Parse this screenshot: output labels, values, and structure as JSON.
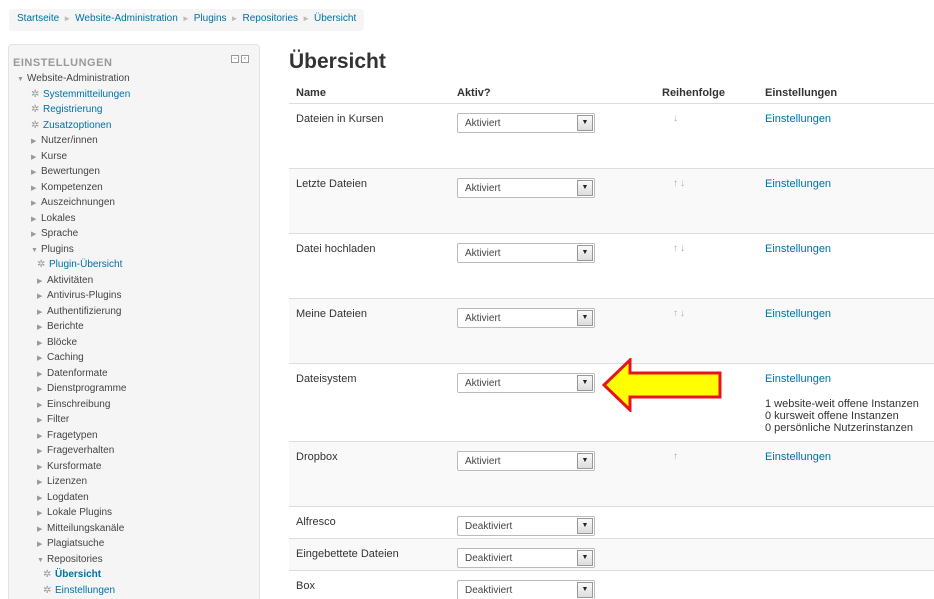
{
  "breadcrumb": {
    "items": [
      "Startseite",
      "Website-Administration",
      "Plugins",
      "Repositories"
    ],
    "current": "Übersicht",
    "separator": "►"
  },
  "sidebar": {
    "title": "EINSTELLUNGEN",
    "items": [
      {
        "label": "Website-Administration",
        "kind": "expanded",
        "level": 1
      },
      {
        "label": "Systemmitteilungen",
        "kind": "gear",
        "level": 2,
        "link": true
      },
      {
        "label": "Registrierung",
        "kind": "gear",
        "level": 2,
        "link": true
      },
      {
        "label": "Zusatzoptionen",
        "kind": "gear",
        "level": 2,
        "link": true
      },
      {
        "label": "Nutzer/innen",
        "kind": "collapsed",
        "level": 2
      },
      {
        "label": "Kurse",
        "kind": "collapsed",
        "level": 2
      },
      {
        "label": "Bewertungen",
        "kind": "collapsed",
        "level": 2
      },
      {
        "label": "Kompetenzen",
        "kind": "collapsed",
        "level": 2
      },
      {
        "label": "Auszeichnungen",
        "kind": "collapsed",
        "level": 2
      },
      {
        "label": "Lokales",
        "kind": "collapsed",
        "level": 2
      },
      {
        "label": "Sprache",
        "kind": "collapsed",
        "level": 2
      },
      {
        "label": "Plugins",
        "kind": "expanded",
        "level": 2
      },
      {
        "label": "Plugin-Übersicht",
        "kind": "gear",
        "level": 3,
        "link": true
      },
      {
        "label": "Aktivitäten",
        "kind": "collapsed",
        "level": 3
      },
      {
        "label": "Antivirus-Plugins",
        "kind": "collapsed",
        "level": 3
      },
      {
        "label": "Authentifizierung",
        "kind": "collapsed",
        "level": 3
      },
      {
        "label": "Berichte",
        "kind": "collapsed",
        "level": 3
      },
      {
        "label": "Blöcke",
        "kind": "collapsed",
        "level": 3
      },
      {
        "label": "Caching",
        "kind": "collapsed",
        "level": 3
      },
      {
        "label": "Datenformate",
        "kind": "collapsed",
        "level": 3
      },
      {
        "label": "Dienstprogramme",
        "kind": "collapsed",
        "level": 3
      },
      {
        "label": "Einschreibung",
        "kind": "collapsed",
        "level": 3
      },
      {
        "label": "Filter",
        "kind": "collapsed",
        "level": 3
      },
      {
        "label": "Fragetypen",
        "kind": "collapsed",
        "level": 3
      },
      {
        "label": "Frageverhalten",
        "kind": "collapsed",
        "level": 3
      },
      {
        "label": "Kursformate",
        "kind": "collapsed",
        "level": 3
      },
      {
        "label": "Lizenzen",
        "kind": "collapsed",
        "level": 3
      },
      {
        "label": "Logdaten",
        "kind": "collapsed",
        "level": 3
      },
      {
        "label": "Lokale Plugins",
        "kind": "collapsed",
        "level": 3
      },
      {
        "label": "Mitteilungskanäle",
        "kind": "collapsed",
        "level": 3
      },
      {
        "label": "Plagiatsuche",
        "kind": "collapsed",
        "level": 3
      },
      {
        "label": "Repositories",
        "kind": "expanded",
        "level": 3
      },
      {
        "label": "Übersicht",
        "kind": "gear",
        "level": 4,
        "link": true,
        "bold": true
      },
      {
        "label": "Einstellungen",
        "kind": "gear",
        "level": 4,
        "link": true
      }
    ]
  },
  "main": {
    "title": "Übersicht",
    "columns": [
      "Name",
      "Aktiv?",
      "Reihenfolge",
      "Einstellungen"
    ],
    "rows": [
      {
        "name": "Dateien in Kursen",
        "status": "Aktiviert",
        "order": "↓",
        "settings": "Einstellungen",
        "info": []
      },
      {
        "name": "Letzte Dateien",
        "status": "Aktiviert",
        "order": "↑↓",
        "settings": "Einstellungen",
        "info": []
      },
      {
        "name": "Datei hochladen",
        "status": "Aktiviert",
        "order": "↑↓",
        "settings": "Einstellungen",
        "info": []
      },
      {
        "name": "Meine Dateien",
        "status": "Aktiviert",
        "order": "↑↓",
        "settings": "Einstellungen",
        "info": []
      },
      {
        "name": "Dateisystem",
        "status": "Aktiviert",
        "order": "",
        "settings": "Einstellungen",
        "info": [
          "1 website-weit offene Instanzen",
          "0 kursweit offene Instanzen",
          "0 persönliche Nutzerinstanzen"
        ]
      },
      {
        "name": "Dropbox",
        "status": "Aktiviert",
        "order": "↑",
        "settings": "Einstellungen",
        "info": []
      },
      {
        "name": "Alfresco",
        "status": "Deaktiviert",
        "order": "",
        "settings": "",
        "info": []
      },
      {
        "name": "Eingebettete Dateien",
        "status": "Deaktiviert",
        "order": "",
        "settings": "",
        "info": []
      },
      {
        "name": "Box",
        "status": "Deaktiviert",
        "order": "",
        "settings": "",
        "info": []
      }
    ]
  },
  "colors": {
    "link": "#0070a8",
    "arrow_fill": "#ffff00",
    "arrow_stroke": "#e8141b"
  }
}
